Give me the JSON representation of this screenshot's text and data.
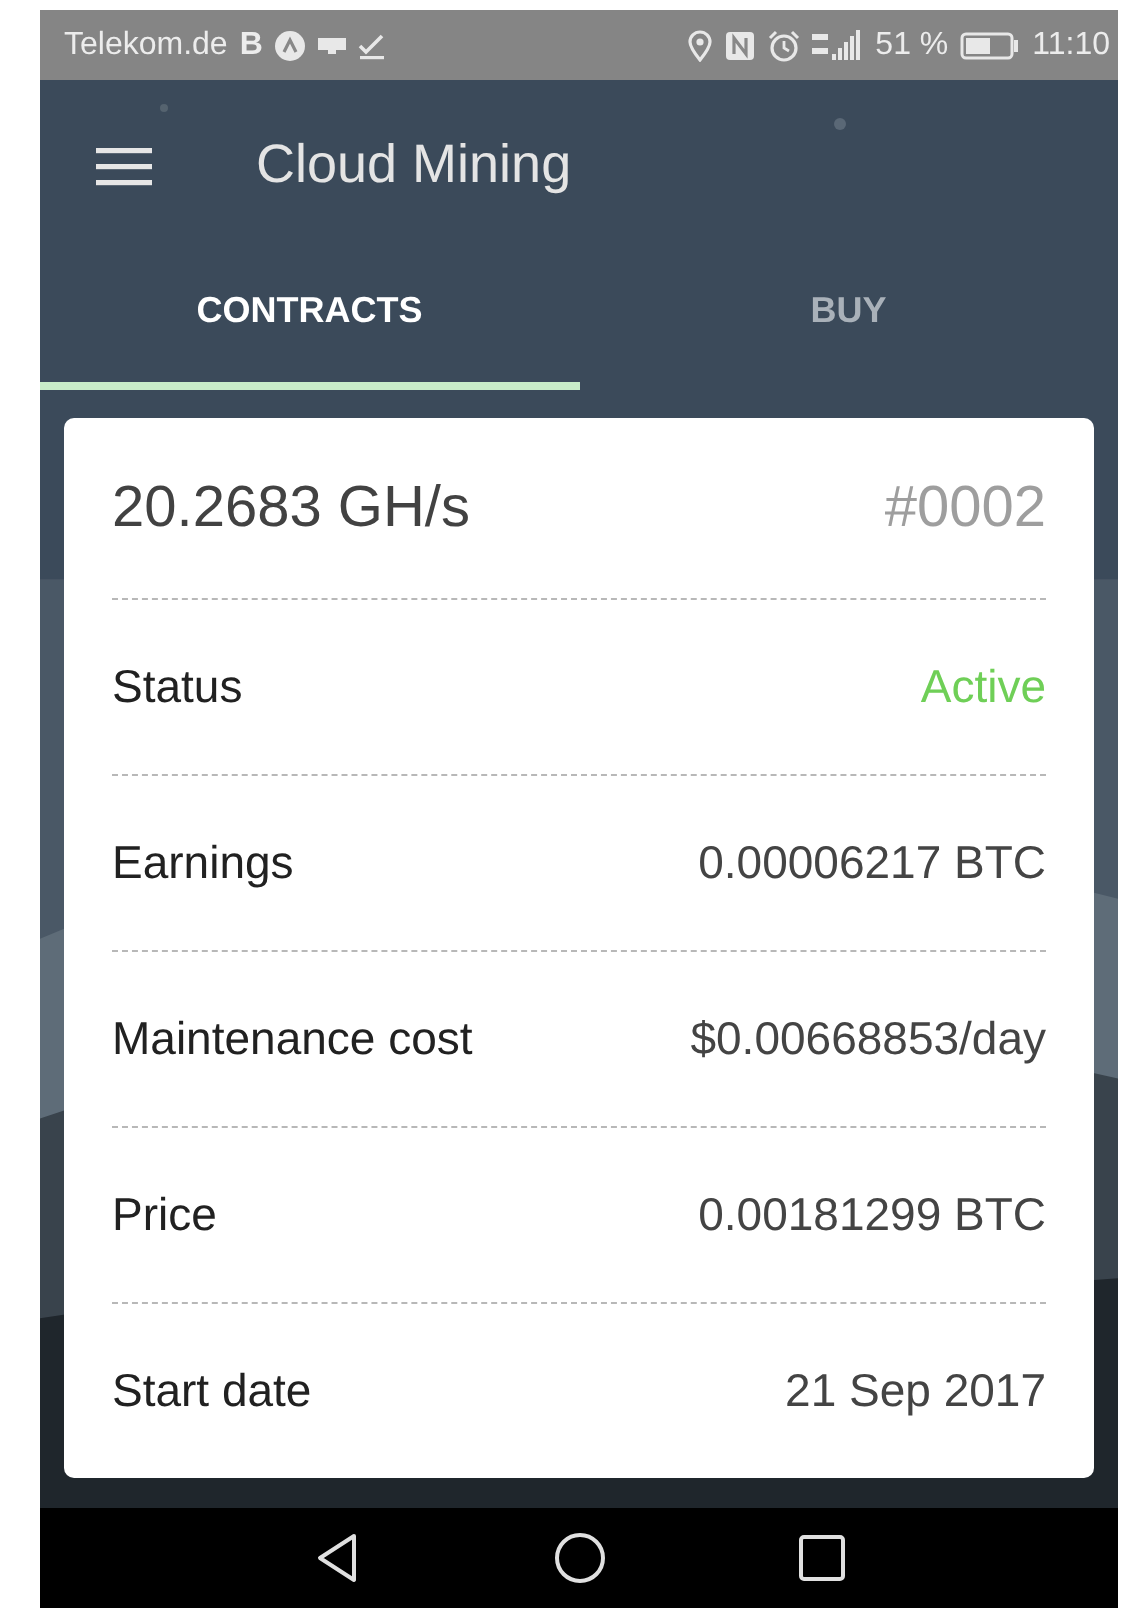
{
  "status_bar": {
    "carrier": "Telekom.de",
    "carrier_badge": "B",
    "battery_percent": "51 %",
    "time": "11:10"
  },
  "app_bar": {
    "title": "Cloud Mining"
  },
  "tabs": [
    {
      "label": "CONTRACTS",
      "selected": true
    },
    {
      "label": "BUY",
      "selected": false
    }
  ],
  "contract": {
    "hashrate": "20.2683 GH/s",
    "number": "#0002",
    "rows": [
      {
        "label": "Status",
        "value": "Active",
        "kind": "status"
      },
      {
        "label": "Earnings",
        "value": "0.00006217 BTC",
        "kind": "plain"
      },
      {
        "label": "Maintenance cost",
        "value": "$0.00668853/day",
        "kind": "plain"
      },
      {
        "label": "Price",
        "value": "0.00181299 BTC",
        "kind": "plain"
      },
      {
        "label": "Start date",
        "value": "21 Sep 2017",
        "kind": "plain"
      }
    ]
  }
}
